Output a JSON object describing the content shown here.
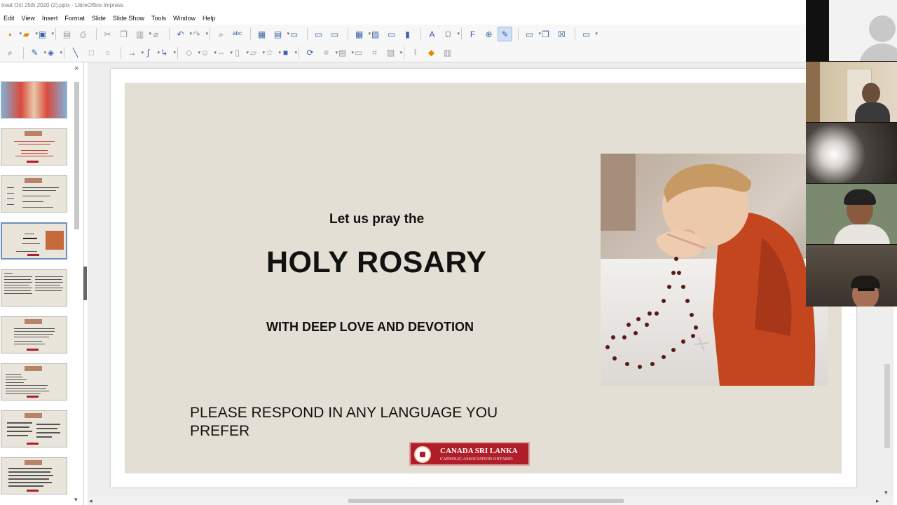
{
  "window": {
    "title": "treat  Oct 25th 2020 (2).pptx - LibreOffice Impress"
  },
  "menu": [
    "Edit",
    "View",
    "Insert",
    "Format",
    "Slide",
    "Slide Show",
    "Tools",
    "Window",
    "Help"
  ],
  "toolbar": {
    "standard_icons": [
      "new-icon",
      "open-icon",
      "save-icon",
      "export-pdf-icon",
      "print-icon",
      "cut-icon",
      "copy-icon",
      "paste-icon",
      "clone-formatting-icon",
      "undo-icon",
      "redo-icon",
      "find-replace-icon",
      "spelling-icon",
      "display-grid-icon",
      "display-views-icon",
      "master-slide-icon",
      "start-first-icon",
      "start-current-icon",
      "table-icon",
      "image-icon",
      "media-icon",
      "chart-icon",
      "textbox-icon",
      "special-character-icon",
      "fontwork-icon",
      "hyperlink-icon",
      "show-draw-functions-icon",
      "new-slide-icon",
      "duplicate-slide-icon",
      "delete-slide-icon",
      "slide-layout-icon"
    ],
    "drawing_icons": [
      "zoom-icon",
      "line-color-icon",
      "fill-color-icon",
      "line-icon",
      "rectangle-icon",
      "ellipse-icon",
      "arrow-icon",
      "curve-icon",
      "connector-icon",
      "basic-shapes-icon",
      "symbol-shapes-icon",
      "block-arrows-icon",
      "flowchart-icon",
      "callouts-icon",
      "stars-icon",
      "3d-objects-icon",
      "rotate-icon",
      "align-icon",
      "arrange-icon",
      "shadow-icon",
      "crop-icon",
      "filter-icon",
      "points-icon",
      "glue-points-icon",
      "toggle-extrusion-icon"
    ]
  },
  "slides_pane": {
    "slide_count_visible": 9,
    "selected_index": 3
  },
  "slide": {
    "heading_small": "Let us pray the",
    "heading_main": "HOLY ROSARY",
    "subheading": "WITH DEEP LOVE AND DEVOTION",
    "note": "PLEASE RESPOND IN ANY LANGUAGE YOU PREFER",
    "logo_line1": "CANADA SRI LANKA",
    "logo_line2": "CATHOLIC ASSOCIATION ONTARIO",
    "background_color": "#e4dfd4"
  },
  "video_call": {
    "participant_count": 5
  }
}
